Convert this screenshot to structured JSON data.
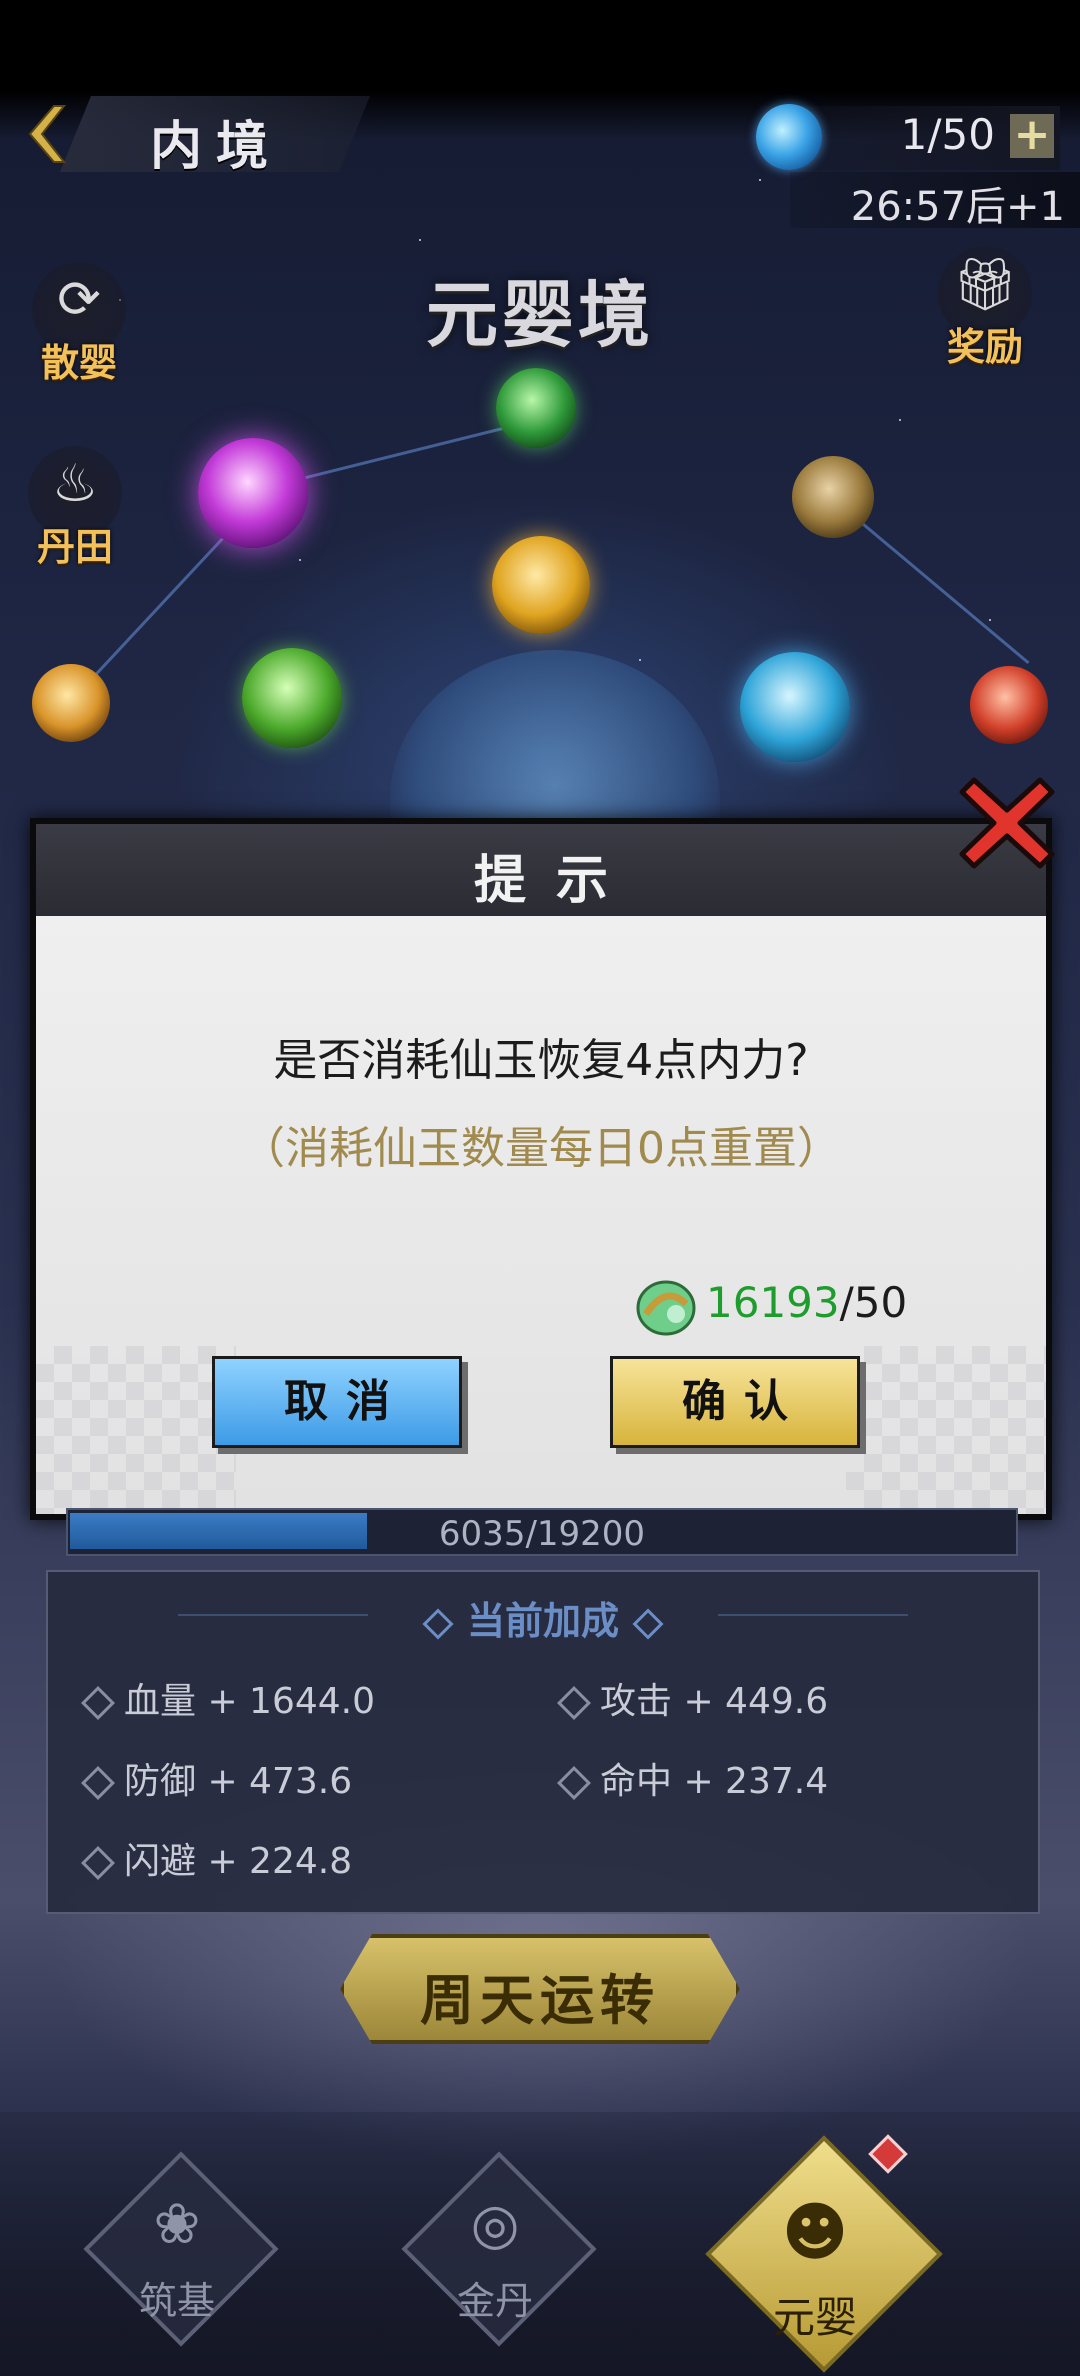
{
  "header": {
    "title": "内境",
    "energy": "1/50",
    "plus_label": "+",
    "timer": "26:57后+1"
  },
  "realm": {
    "title": "元婴境"
  },
  "side_buttons": {
    "disperse": "散婴",
    "dantian": "丹田",
    "reward": "奖励"
  },
  "dialog": {
    "title": "提示",
    "question": "是否消耗仙玉恢复4点内力?",
    "note": "（消耗仙玉数量每日0点重置）",
    "cost_have": "16193",
    "cost_need": "/50",
    "cancel_label": "取消",
    "confirm_label": "确认"
  },
  "progress": {
    "text": "6035/19200",
    "fraction": 0.3143
  },
  "bonus": {
    "title": "当前加成",
    "stats": [
      {
        "label": "血量 + 1644.0"
      },
      {
        "label": "攻击 + 449.6"
      },
      {
        "label": "防御 + 473.6"
      },
      {
        "label": "命中 + 237.4"
      },
      {
        "label": "闪避 + 224.8"
      }
    ]
  },
  "cycle_button": "周天运转",
  "nav": {
    "items": [
      {
        "label": "筑基"
      },
      {
        "label": "金丹"
      },
      {
        "label": "元婴"
      }
    ],
    "active": "元婴"
  },
  "colors": {
    "accent_gold": "#d7b43c",
    "accent_blue": "#3d9be6",
    "cost_green": "#1f9c2e",
    "note_brown": "#a08a4e"
  }
}
